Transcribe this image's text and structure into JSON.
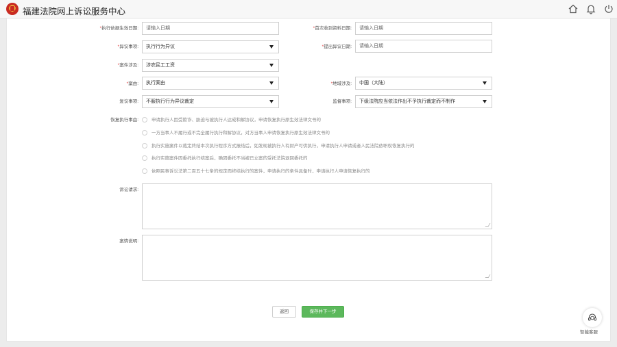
{
  "header": {
    "title": "福建法院网上诉讼服务中心",
    "icons": [
      "home-icon",
      "bell-icon",
      "power-icon"
    ]
  },
  "form": {
    "exec_basis_date": {
      "label": "执行依据生效日期:",
      "required": "*",
      "placeholder": "请输入日期"
    },
    "first_receive_date": {
      "label": "首次收到资料日期:",
      "required": "*",
      "placeholder": "请输入日期"
    },
    "objection_matter": {
      "label": "异议事项:",
      "required": "*",
      "value": "执行行为异议"
    },
    "objection_date": {
      "label": "提出异议日期:",
      "required": "*",
      "placeholder": "请输入日期"
    },
    "case_involves": {
      "label": "案件涉及:",
      "required": "*",
      "value": "涉农民工工资"
    },
    "cause": {
      "label": "案由:",
      "required": "*",
      "value": "执行案由"
    },
    "region": {
      "label": "地域涉及:",
      "required": "*",
      "value": "中国（大陆）"
    },
    "review_matter": {
      "label": "复议事项:",
      "value": "不服执行行为异议裁定"
    },
    "supervision_matter": {
      "label": "监督事项:",
      "value": "下级法院应当依法作出不予执行裁定而不制作"
    },
    "resume_reason": {
      "label": "恢复执行事由:",
      "options": [
        "申请执行人因受欺诈、胁迫与被执行人达成和解协议，申请恢复执行原生效法律文书的",
        "一方当事人不履行或不完全履行执行和解协议，对方当事人申请恢复执行原生效法律文书的",
        "执行实施案件以裁定终结本次执行程序方式报结后，如发现被执行人有财产可供执行，申请执行人申请或者人民法院依职权恢复执行的",
        "执行实施案件因委托执行结案后，确因委托不当被已立案的受托法院退回委托的",
        "依照民事诉讼法第二百五十七条的规定而终结执行的案件，申请执行的条件具备时，申请执行人申请恢复执行的"
      ]
    },
    "claims": {
      "label": "诉讼请求:",
      "value": ""
    },
    "case_desc": {
      "label": "案情说明:",
      "value": ""
    }
  },
  "buttons": {
    "back": "返回",
    "next": "保存并下一步"
  },
  "assistant": {
    "label": "智能客服",
    "icon": "headset-icon"
  },
  "colors": {
    "primary_button": "#5cb85c",
    "required_mark": "#e23b3b",
    "logo_red": "#c92b22",
    "logo_gold": "#f2c541"
  }
}
